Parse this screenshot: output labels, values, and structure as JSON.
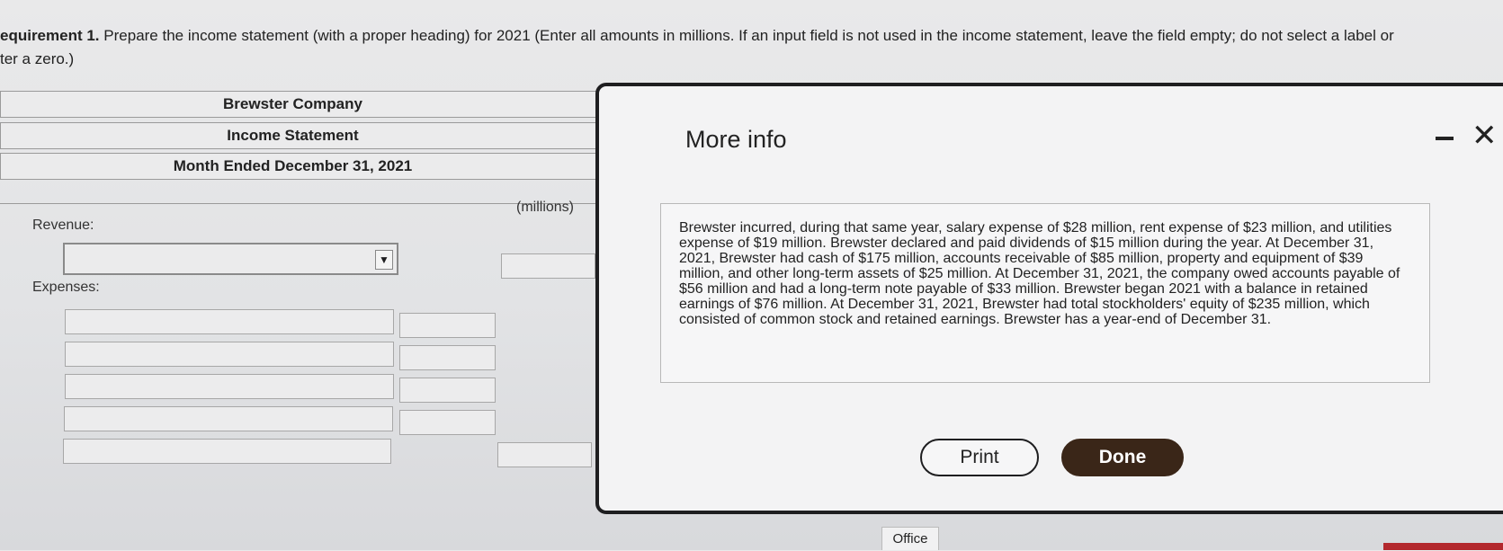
{
  "instructions": {
    "req_label": "equirement 1.",
    "text": "Prepare the income statement (with a proper heading) for 2021 (Enter all amounts in millions. If an input field is not used in the income statement, leave the field empty; do not select a label or",
    "text_line2": "ter a zero.)"
  },
  "statement": {
    "company": "Brewster Company",
    "title": "Income Statement",
    "period": "Month Ended December 31, 2021",
    "units": "(millions)",
    "revenue_label": "Revenue:",
    "expenses_label": "Expenses:"
  },
  "modal": {
    "title": "More info",
    "body": "Brewster incurred, during that same year, salary expense of $28 million, rent expense of $23 million, and utilities expense of $19 million. Brewster declared and paid dividends of $15 million during the year. At December 31, 2021, Brewster had cash of $175 million, accounts receivable of $85 million, property and equipment of $39 million, and other long-term assets of $25 million. At December 31, 2021, the company owed accounts payable of $56 million and had a long-term note payable of $33 million. Brewster began 2021 with a balance in retained earnings of $76 million. At December 31, 2021, Brewster had total stockholders' equity of $235 million, which consisted of common stock and retained earnings. Brewster has a year-end of December 31.",
    "print_label": "Print",
    "done_label": "Done"
  },
  "footer": {
    "office_tab": "Office"
  }
}
